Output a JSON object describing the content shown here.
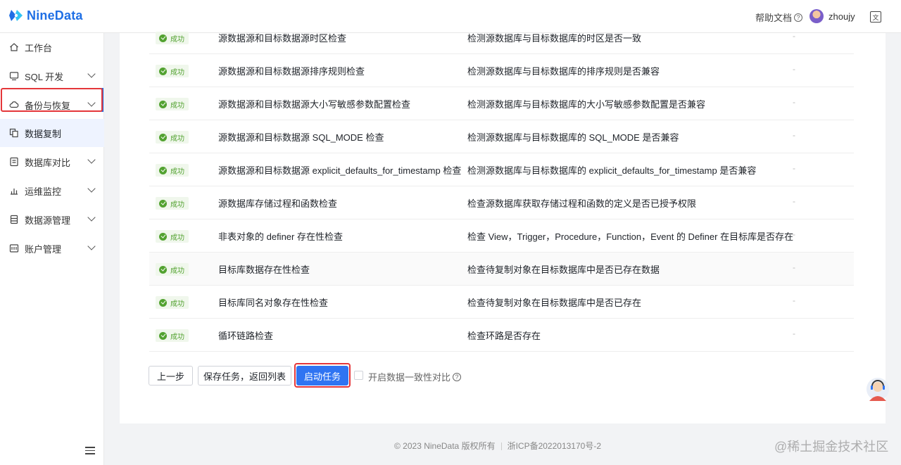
{
  "brand": {
    "name": "NineData",
    "color": "#1f6fe5"
  },
  "header": {
    "help_label": "帮助文档",
    "username": "zhoujy",
    "lang_icon": "translate-icon"
  },
  "sidebar": {
    "items": [
      {
        "label": "工作台",
        "icon": "home-icon",
        "has_children": false
      },
      {
        "label": "SQL 开发",
        "icon": "monitor-icon",
        "has_children": true
      },
      {
        "label": "备份与恢复",
        "icon": "cloud-icon",
        "has_children": true
      },
      {
        "label": "数据复制",
        "icon": "copy-icon",
        "has_children": false,
        "active": true
      },
      {
        "label": "数据库对比",
        "icon": "compare-icon",
        "has_children": true
      },
      {
        "label": "运维监控",
        "icon": "monitor-chart-icon",
        "has_children": true
      },
      {
        "label": "数据源管理",
        "icon": "database-icon",
        "has_children": true
      },
      {
        "label": "账户管理",
        "icon": "account-icon",
        "has_children": true
      }
    ]
  },
  "checks": [
    {
      "status": "成功",
      "name": "源数据源和目标数据源时区检查",
      "desc": "检测源数据库与目标数据库的时区是否一致",
      "extra": "-"
    },
    {
      "status": "成功",
      "name": "源数据源和目标数据源排序规则检查",
      "desc": "检测源数据库与目标数据库的排序规则是否兼容",
      "extra": "-"
    },
    {
      "status": "成功",
      "name": "源数据源和目标数据源大小写敏感参数配置检查",
      "desc": "检测源数据库与目标数据库的大小写敏感参数配置是否兼容",
      "extra": "-"
    },
    {
      "status": "成功",
      "name": "源数据源和目标数据源 SQL_MODE 检查",
      "desc": "检测源数据库与目标数据库的 SQL_MODE 是否兼容",
      "extra": "-"
    },
    {
      "status": "成功",
      "name": "源数据源和目标数据源 explicit_defaults_for_timestamp 检查",
      "desc": "检测源数据库与目标数据库的 explicit_defaults_for_timestamp 是否兼容",
      "extra": "-"
    },
    {
      "status": "成功",
      "name": "源数据库存储过程和函数检查",
      "desc": "检查源数据库获取存储过程和函数的定义是否已授予权限",
      "extra": "-"
    },
    {
      "status": "成功",
      "name": "非表对象的 definer 存在性检查",
      "desc": "检查 View，Trigger，Procedure，Function，Event 的 Definer 在目标库是否存在",
      "extra": "-"
    },
    {
      "status": "成功",
      "name": "目标库数据存在性检查",
      "desc": "检查待复制对象在目标数据库中是否已存在数据",
      "extra": "-"
    },
    {
      "status": "成功",
      "name": "目标库同名对象存在性检查",
      "desc": "检查待复制对象在目标数据库中是否已存在",
      "extra": "-"
    },
    {
      "status": "成功",
      "name": "循环链路检查",
      "desc": "检查环路是否存在",
      "extra": "-"
    }
  ],
  "actions": {
    "prev": "上一步",
    "save": "保存任务，返回列表",
    "start": "启动任务",
    "consistency": "开启数据一致性对比"
  },
  "footer": {
    "copyright": "© 2023 NineData 版权所有",
    "icp": "浙ICP备2022013170号-2"
  },
  "watermark": "@稀土掘金技术社区"
}
